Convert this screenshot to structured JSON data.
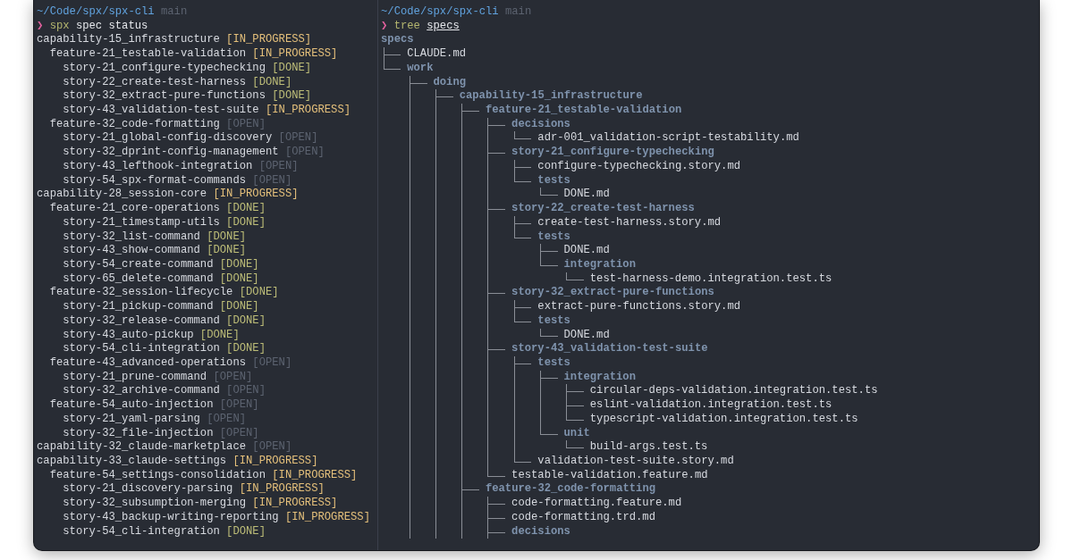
{
  "left_pane": {
    "path": "~/Code/spx/spx-cli",
    "branch": "main",
    "prompt": "❯",
    "command": {
      "program": "spx",
      "args": "spec status",
      "underlined": false
    },
    "items": [
      {
        "name": "capability-15_infrastructure",
        "status": "[IN_PROGRESS]",
        "color": "#e5c07b",
        "children": [
          {
            "name": "feature-21_testable-validation",
            "status": "[IN_PROGRESS]",
            "color": "#e5c07b",
            "children": [
              {
                "name": "story-21_configure-typechecking",
                "status": "[DONE]",
                "color": "#bdbd78"
              },
              {
                "name": "story-22_create-test-harness",
                "status": "[DONE]",
                "color": "#bdbd78"
              },
              {
                "name": "story-32_extract-pure-functions",
                "status": "[DONE]",
                "color": "#bdbd78"
              },
              {
                "name": "story-43_validation-test-suite",
                "status": "[IN_PROGRESS]",
                "color": "#e5c07b"
              }
            ]
          },
          {
            "name": "feature-32_code-formatting",
            "status": "[OPEN]",
            "color": "#5c6370",
            "children": [
              {
                "name": "story-21_global-config-discovery",
                "status": "[OPEN]",
                "color": "#5c6370"
              },
              {
                "name": "story-32_dprint-config-management",
                "status": "[OPEN]",
                "color": "#5c6370"
              },
              {
                "name": "story-43_lefthook-integration",
                "status": "[OPEN]",
                "color": "#5c6370"
              },
              {
                "name": "story-54_spx-format-commands",
                "status": "[OPEN]",
                "color": "#5c6370"
              }
            ]
          }
        ]
      },
      {
        "name": "capability-28_session-core",
        "status": "[IN_PROGRESS]",
        "color": "#e5c07b",
        "children": [
          {
            "name": "feature-21_core-operations",
            "status": "[DONE]",
            "color": "#bdbd78",
            "children": [
              {
                "name": "story-21_timestamp-utils",
                "status": "[DONE]",
                "color": "#bdbd78"
              },
              {
                "name": "story-32_list-command",
                "status": "[DONE]",
                "color": "#bdbd78"
              },
              {
                "name": "story-43_show-command",
                "status": "[DONE]",
                "color": "#bdbd78"
              },
              {
                "name": "story-54_create-command",
                "status": "[DONE]",
                "color": "#bdbd78"
              },
              {
                "name": "story-65_delete-command",
                "status": "[DONE]",
                "color": "#bdbd78"
              }
            ]
          },
          {
            "name": "feature-32_session-lifecycle",
            "status": "[DONE]",
            "color": "#bdbd78",
            "children": [
              {
                "name": "story-21_pickup-command",
                "status": "[DONE]",
                "color": "#bdbd78"
              },
              {
                "name": "story-32_release-command",
                "status": "[DONE]",
                "color": "#bdbd78"
              },
              {
                "name": "story-43_auto-pickup",
                "status": "[DONE]",
                "color": "#bdbd78"
              },
              {
                "name": "story-54_cli-integration",
                "status": "[DONE]",
                "color": "#bdbd78"
              }
            ]
          },
          {
            "name": "feature-43_advanced-operations",
            "status": "[OPEN]",
            "color": "#5c6370",
            "children": [
              {
                "name": "story-21_prune-command",
                "status": "[OPEN]",
                "color": "#5c6370"
              },
              {
                "name": "story-32_archive-command",
                "status": "[OPEN]",
                "color": "#5c6370"
              }
            ]
          },
          {
            "name": "feature-54_auto-injection",
            "status": "[OPEN]",
            "color": "#5c6370",
            "children": [
              {
                "name": "story-21_yaml-parsing",
                "status": "[OPEN]",
                "color": "#5c6370"
              },
              {
                "name": "story-32_file-injection",
                "status": "[OPEN]",
                "color": "#5c6370"
              }
            ]
          }
        ]
      },
      {
        "name": "capability-32_claude-marketplace",
        "status": "[OPEN]",
        "color": "#5c6370"
      },
      {
        "name": "capability-33_claude-settings",
        "status": "[IN_PROGRESS]",
        "color": "#e5c07b",
        "children": [
          {
            "name": "feature-54_settings-consolidation",
            "status": "[IN_PROGRESS]",
            "color": "#e5c07b",
            "children": [
              {
                "name": "story-21_discovery-parsing",
                "status": "[IN_PROGRESS]",
                "color": "#e5c07b"
              },
              {
                "name": "story-32_subsumption-merging",
                "status": "[IN_PROGRESS]",
                "color": "#e5c07b"
              },
              {
                "name": "story-43_backup-writing-reporting",
                "status": "[IN_PROGRESS]",
                "color": "#e5c07b"
              },
              {
                "name": "story-54_cli-integration",
                "status": "[DONE]",
                "color": "#bdbd78"
              }
            ]
          }
        ]
      }
    ]
  },
  "right_pane": {
    "path": "~/Code/spx/spx-cli",
    "branch": "main",
    "prompt": "❯",
    "command": {
      "program": "tree",
      "args": "specs",
      "underlined": true
    },
    "tree": {
      "name": "specs",
      "kind": "dir",
      "children": [
        {
          "name": "CLAUDE.md",
          "kind": "file",
          "last": false
        },
        {
          "name": "work",
          "kind": "dir",
          "last": true,
          "children": [
            {
              "name": "doing",
              "kind": "dir",
              "last": false,
              "children": [
                {
                  "name": "capability-15_infrastructure",
                  "kind": "dir",
                  "last": false,
                  "children": [
                    {
                      "name": "feature-21_testable-validation",
                      "kind": "dir",
                      "last": false,
                      "children": [
                        {
                          "name": "decisions",
                          "kind": "dir",
                          "last": false,
                          "children": [
                            {
                              "name": "adr-001_validation-script-testability.md",
                              "kind": "file",
                              "last": true
                            }
                          ]
                        },
                        {
                          "name": "story-21_configure-typechecking",
                          "kind": "dir",
                          "last": false,
                          "children": [
                            {
                              "name": "configure-typechecking.story.md",
                              "kind": "file",
                              "last": false
                            },
                            {
                              "name": "tests",
                              "kind": "dir",
                              "last": true,
                              "children": [
                                {
                                  "name": "DONE.md",
                                  "kind": "file",
                                  "last": true
                                }
                              ]
                            }
                          ]
                        },
                        {
                          "name": "story-22_create-test-harness",
                          "kind": "dir",
                          "last": false,
                          "children": [
                            {
                              "name": "create-test-harness.story.md",
                              "kind": "file",
                              "last": false
                            },
                            {
                              "name": "tests",
                              "kind": "dir",
                              "last": true,
                              "children": [
                                {
                                  "name": "DONE.md",
                                  "kind": "file",
                                  "last": false
                                },
                                {
                                  "name": "integration",
                                  "kind": "dir",
                                  "last": true,
                                  "children": [
                                    {
                                      "name": "test-harness-demo.integration.test.ts",
                                      "kind": "file",
                                      "last": true
                                    }
                                  ]
                                }
                              ]
                            }
                          ]
                        },
                        {
                          "name": "story-32_extract-pure-functions",
                          "kind": "dir",
                          "last": false,
                          "children": [
                            {
                              "name": "extract-pure-functions.story.md",
                              "kind": "file",
                              "last": false
                            },
                            {
                              "name": "tests",
                              "kind": "dir",
                              "last": true,
                              "children": [
                                {
                                  "name": "DONE.md",
                                  "kind": "file",
                                  "last": true
                                }
                              ]
                            }
                          ]
                        },
                        {
                          "name": "story-43_validation-test-suite",
                          "kind": "dir",
                          "last": false,
                          "children": [
                            {
                              "name": "tests",
                              "kind": "dir",
                              "last": false,
                              "children": [
                                {
                                  "name": "integration",
                                  "kind": "dir",
                                  "last": false,
                                  "children": [
                                    {
                                      "name": "circular-deps-validation.integration.test.ts",
                                      "kind": "file",
                                      "last": false
                                    },
                                    {
                                      "name": "eslint-validation.integration.test.ts",
                                      "kind": "file",
                                      "last": false
                                    },
                                    {
                                      "name": "typescript-validation.integration.test.ts",
                                      "kind": "file",
                                      "last": true
                                    }
                                  ]
                                },
                                {
                                  "name": "unit",
                                  "kind": "dir",
                                  "last": true,
                                  "children": [
                                    {
                                      "name": "build-args.test.ts",
                                      "kind": "file",
                                      "last": true
                                    }
                                  ]
                                }
                              ]
                            },
                            {
                              "name": "validation-test-suite.story.md",
                              "kind": "file",
                              "last": true
                            }
                          ]
                        },
                        {
                          "name": "testable-validation.feature.md",
                          "kind": "file",
                          "last": true
                        }
                      ]
                    },
                    {
                      "name": "feature-32_code-formatting",
                      "kind": "dir",
                      "last": false,
                      "children": [
                        {
                          "name": "code-formatting.feature.md",
                          "kind": "file",
                          "last": false
                        },
                        {
                          "name": "code-formatting.trd.md",
                          "kind": "file",
                          "last": false
                        },
                        {
                          "name": "decisions",
                          "kind": "dir",
                          "last": false
                        }
                      ]
                    }
                  ]
                }
              ]
            }
          ]
        }
      ]
    }
  }
}
